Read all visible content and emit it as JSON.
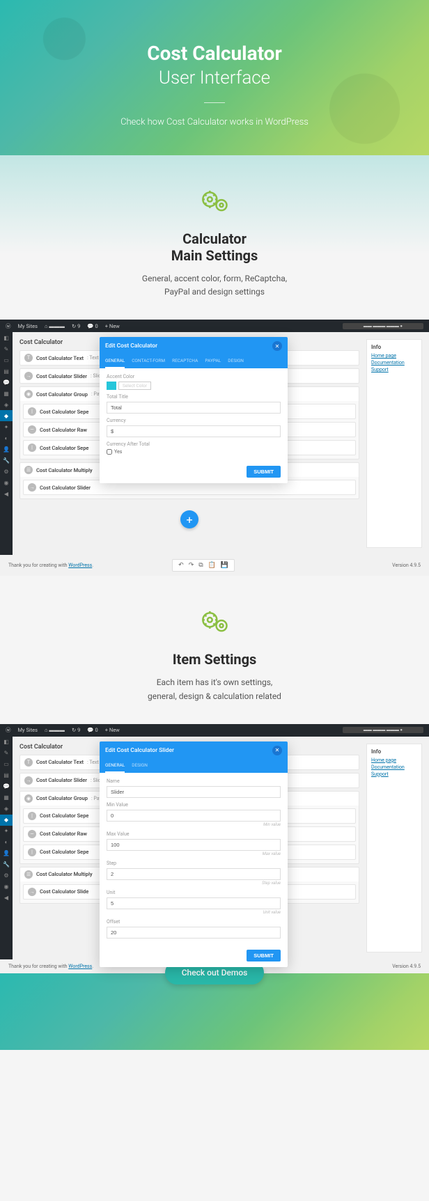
{
  "hero": {
    "title": "Cost Calculator",
    "subtitle": "User Interface",
    "tagline": "Check how Cost Calculator works in WordPress"
  },
  "section1": {
    "heading_l1": "Calculator",
    "heading_l2": "Main Settings",
    "desc_l1": "General, accent color, form, ReCaptcha,",
    "desc_l2": "PayPal and design settings"
  },
  "section2": {
    "heading": "Item Settings",
    "desc_l1": "Each item has it's own settings,",
    "desc_l2": "general, design & calculation related"
  },
  "wp": {
    "adminbar": {
      "mysites": "My Sites",
      "comments": "0",
      "new": "New"
    },
    "info": {
      "title": "Info",
      "links": [
        "Home page",
        "Documentation",
        "Support"
      ]
    },
    "panel_title": "Cost Calculator",
    "rows": {
      "text": {
        "label": "Cost Calculator Text",
        "meta": ": Text"
      },
      "slider": {
        "label": "Cost Calculator Slider",
        "meta": ": Slide"
      },
      "group": {
        "label": "Cost Calculator Group",
        "meta": ": PayP"
      },
      "sep1": {
        "label": "Cost Calculator Sepe"
      },
      "raw": {
        "label": "Cost Calculator Raw"
      },
      "sep2": {
        "label": "Cost Calculator Sepe"
      },
      "multiply": {
        "label": "Cost Calculator Multiply"
      },
      "slider2": {
        "label": "Cost Calculator Slider"
      },
      "slider3": {
        "label": "Cost Calculator Slide"
      }
    },
    "footer": {
      "thanks": "Thank you for creating with ",
      "wp": "WordPress",
      "version": "Version 4.9.5"
    }
  },
  "modal1": {
    "title": "Edit Cost Calculator",
    "tabs": [
      "GENERAL",
      "CONTACT-FORM",
      "RECAPTCHA",
      "PAYPAL",
      "DESIGN"
    ],
    "fields": {
      "accent_label": "Accent Color",
      "select_color": "Select Color",
      "total_title_label": "Total Title",
      "total_title_value": "Total",
      "currency_label": "Currency",
      "currency_value": "$",
      "currency_after_label": "Currency After Total",
      "yes": "Yes"
    },
    "submit": "SUBMIT"
  },
  "modal2": {
    "title": "Edit Cost Calculator Slider",
    "tabs": [
      "GENERAL",
      "DESIGN"
    ],
    "fields": {
      "name_label": "Name",
      "name_value": "Slider",
      "min_label": "Min Value",
      "min_value": "0",
      "min_hint": "Min value",
      "max_label": "Max Value",
      "max_value": "100",
      "max_hint": "Max value",
      "step_label": "Step",
      "step_value": "2",
      "step_hint": "Step value",
      "unit_label": "Unit",
      "unit_value": "5",
      "unit_hint": "Unit value",
      "offset_label": "Offset",
      "offset_value": "20"
    },
    "submit": "SUBMIT"
  },
  "demo_button": "Check out Demos"
}
